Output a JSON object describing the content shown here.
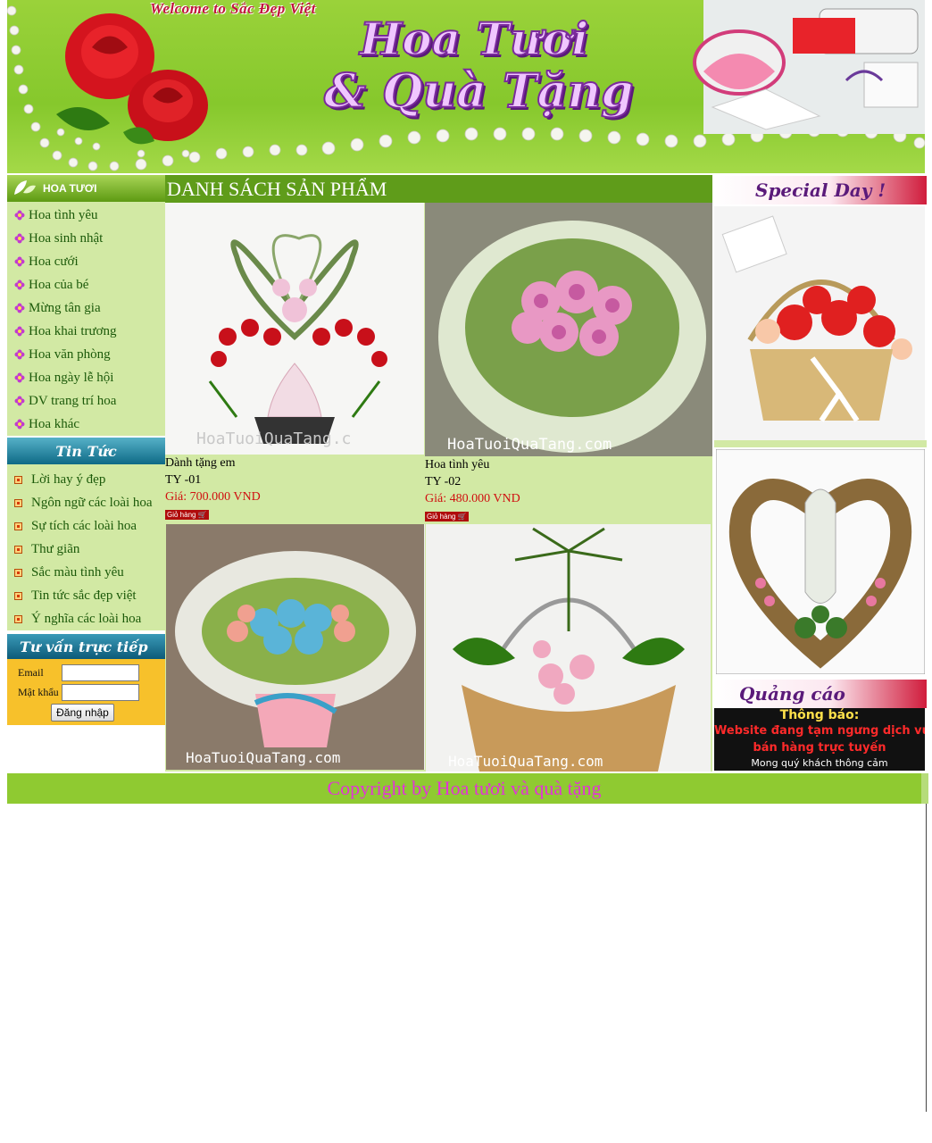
{
  "banner": {
    "welcome": "Welcome to Sắc Đẹp Việt",
    "title_line1": "Hoa Tươi",
    "title_line2": "& Quà Tặng"
  },
  "left": {
    "category_header": "HOA TƯƠI",
    "categories": [
      "Hoa tình yêu",
      "Hoa sinh nhật",
      "Hoa cưới",
      "Hoa của bé",
      "Mừng tân gia",
      "Hoa khai trương",
      "Hoa văn phòng",
      "Hoa ngày lễ hội",
      "DV trang trí hoa",
      "Hoa khác"
    ],
    "news_header": "Tin Tức",
    "news": [
      "Lời hay ý đẹp",
      "Ngôn ngữ các loài hoa",
      "Sự tích các loài hoa",
      "Thư giãn",
      "Sắc màu tình yêu",
      "Tin tức sắc đẹp việt",
      "Ý nghĩa các loài hoa"
    ],
    "consult_header": "Tư vấn trực tiếp",
    "login": {
      "email_label": "Email",
      "password_label": "Mật khẩu",
      "submit_label": "Đăng nhập"
    }
  },
  "center": {
    "header": "DANH SÁCH SẢN PHẨM",
    "products": [
      {
        "name": "Dành tặng em",
        "code": "TY -01",
        "price": "Giá: 700.000 VND",
        "cart_label": "Giỏ hàng",
        "watermark": "HoaTuoiQuaTang.c"
      },
      {
        "name": "Hoa tình yêu",
        "code": "TY -02",
        "price": "Giá: 480.000 VND",
        "cart_label": "Giỏ hàng",
        "watermark": "HoaTuoiQuaTang.com"
      },
      {
        "watermark": "HoaTuoiQuaTang.com"
      },
      {
        "watermark": "HoaTuoiQuaTang.com"
      }
    ]
  },
  "right": {
    "special_header": "Special Day !",
    "ads_header": "Quảng cáo",
    "notice": {
      "title": "Thông báo:",
      "line1": "Website đang tạm ngưng dịch vụ",
      "line2": "bán hàng trực tuyến",
      "line3": "Mong quý khách thông cảm"
    }
  },
  "footer": {
    "copyright": "Copyright by Hoa tươi và quà tặng"
  },
  "colors": {
    "banner_green": "#86c82c",
    "menu_bg": "#d2e9a4",
    "header_green": "#5f9c1a",
    "price_red": "#d01010",
    "footer_pink": "#e234d6"
  }
}
